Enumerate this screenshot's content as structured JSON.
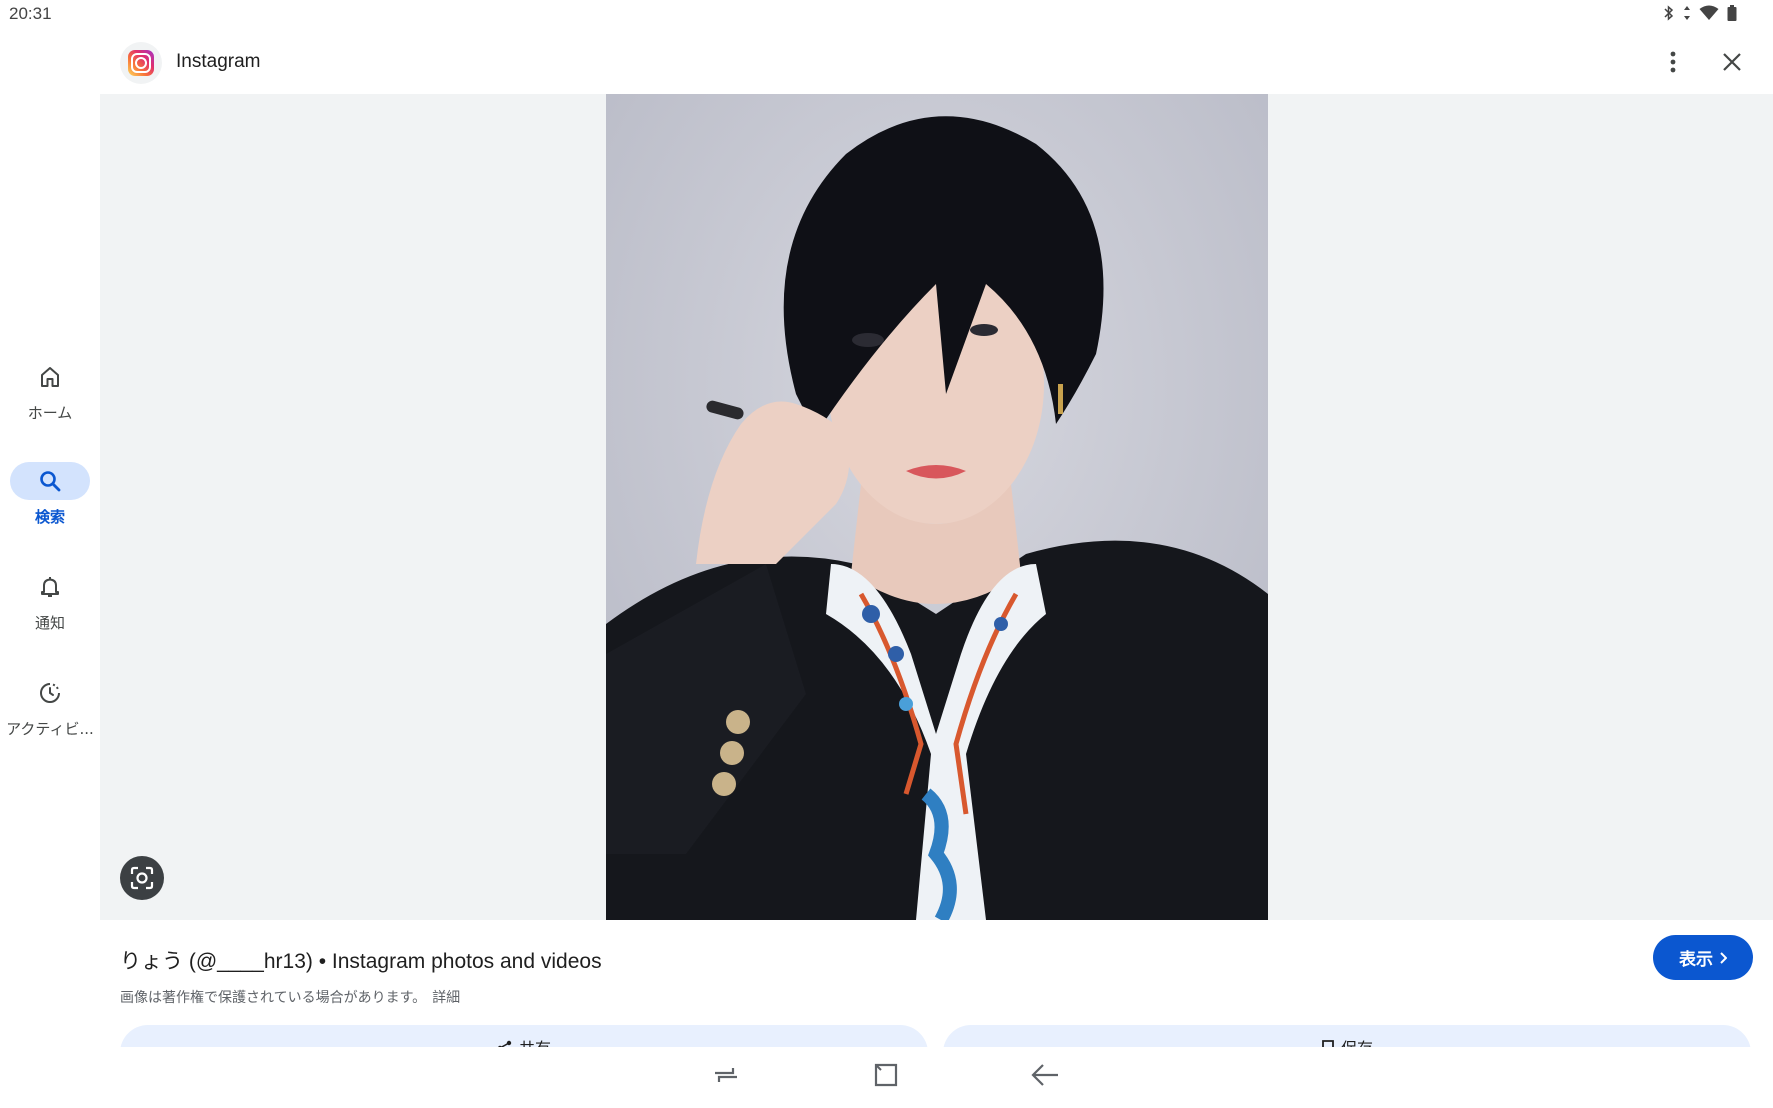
{
  "status_bar": {
    "time": "20:31",
    "icons": [
      "bluetooth-icon",
      "data-arrows-icon",
      "wifi-icon",
      "battery-icon"
    ]
  },
  "app_bar": {
    "app_name": "Instagram",
    "logo_icon": "instagram-logo",
    "more_icon": "more-vert-icon",
    "close_icon": "close-icon"
  },
  "side_nav": {
    "items": [
      {
        "label": "ホーム",
        "icon": "home-icon",
        "active": false
      },
      {
        "label": "検索",
        "icon": "search-icon",
        "active": true
      },
      {
        "label": "通知",
        "icon": "bell-icon",
        "active": false
      },
      {
        "label": "アクティビ...",
        "icon": "activity-icon",
        "active": false
      }
    ]
  },
  "result": {
    "title": "りょう (@____hr13) • Instagram photos and videos",
    "copyright_notice": "画像は著作権で保護されている場合があります。",
    "detail_link": "詳細",
    "view_button": "表示",
    "share_button": "共有",
    "save_button": "保存"
  },
  "colors": {
    "accent": "#0b57d0",
    "active_pill": "#d3e3fd",
    "image_bg": "#f1f3f4"
  }
}
